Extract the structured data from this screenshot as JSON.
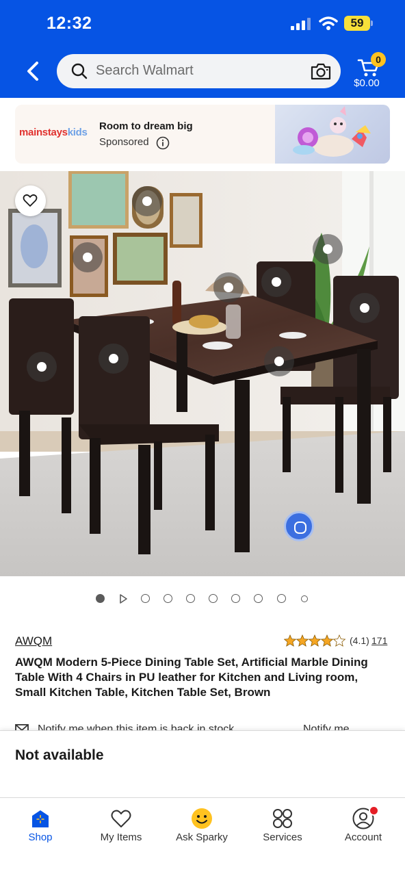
{
  "status_bar": {
    "time": "12:32",
    "battery_level": "59"
  },
  "header": {
    "search_placeholder": "Search Walmart",
    "cart_count": "0",
    "cart_total": "$0.00",
    "icons": [
      "back-arrow-icon",
      "search-icon",
      "camera-icon",
      "cart-icon"
    ],
    "colors": {
      "header_bg": "#0654e4",
      "badge": "#ffc220"
    }
  },
  "ad": {
    "brand_logo": "mainstayskids",
    "brand_logo_main": "mainstays",
    "brand_logo_kids": "kids",
    "title": "Room to dream big",
    "sponsored_label": "Sponsored"
  },
  "product": {
    "image_count": 10,
    "current_image": 1,
    "brand": "AWQM",
    "rating": 4.1,
    "rating_text": "(4.1)",
    "review_count": "171",
    "title": "AWQM Modern 5-Piece Dining Table Set, Artificial Marble Dining Table With 4 Chairs in PU leather for Kitchen and Living room, Small Kitchen Table, Kitchen Table Set, Brown",
    "notify_text": "Notify me when this item is back in stock",
    "notify_link": "Notify me"
  },
  "availability": {
    "status": "Not available"
  },
  "bottom_nav": {
    "items": [
      {
        "label": "Shop",
        "icon": "shop-icon"
      },
      {
        "label": "My Items",
        "icon": "heart-icon"
      },
      {
        "label": "Ask Sparky",
        "icon": "sparky-icon"
      },
      {
        "label": "Services",
        "icon": "services-grid-icon"
      },
      {
        "label": "Account",
        "icon": "account-icon"
      }
    ],
    "active_index": 0,
    "active_color": "#0654e4"
  }
}
